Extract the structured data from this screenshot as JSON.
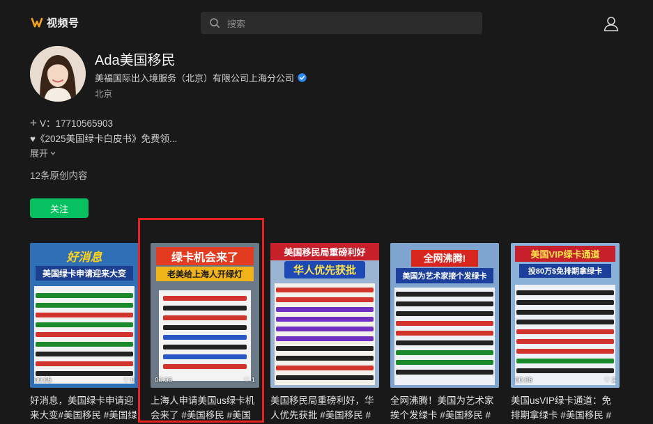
{
  "header": {
    "app_name": "视频号",
    "search_placeholder": "搜索",
    "user_icon": "user-icon"
  },
  "profile": {
    "name": "Ada美国移民",
    "company": "美福国际出入境服务（北京）有限公司上海分公司",
    "location": "北京",
    "contact": "V：17710565903",
    "description": "♥《2025美国绿卡白皮书》免费领...",
    "expand_label": "展开",
    "content_count": "12条原创内容",
    "follow_label": "关注"
  },
  "colors": {
    "accent": "#07c160",
    "background": "#191919",
    "highlight": "#e8231f",
    "verified": "#2f86f6"
  },
  "videos": [
    {
      "banner_top": "好消息",
      "banner_bottom": "美国绿卡申请迎来大变",
      "duration": "00:05",
      "likes": "0",
      "caption": "好消息，美国绿卡申请迎来大变#美国移民 #美国绿卡"
    },
    {
      "banner_top": "绿卡机会来了",
      "banner_bottom": "老美给上海人开绿灯",
      "duration": "00:06",
      "likes": "1",
      "caption": "上海人申请美国us绿卡机会来了 #美国移民 #美国绿卡"
    },
    {
      "banner_top": "美国移民局重磅利好",
      "banner_bottom": "华人优先获批",
      "duration": "",
      "likes": "",
      "caption": "美国移民局重磅利好，华人优先获批 #美国移民 #美国绿卡"
    },
    {
      "banner_top": "全网沸腾!",
      "banner_bottom": "美国为艺术家接个发绿卡",
      "duration": "",
      "likes": "",
      "caption": "全网沸腾！美国为艺术家挨个发绿卡 #美国移民 #美国绿卡"
    },
    {
      "banner_top": "美国VIP绿卡通道",
      "banner_bottom": "投80万$免排期拿绿卡",
      "duration": "00:08",
      "likes": "2",
      "caption": "美国usVIP绿卡通道：免排期拿绿卡 #美国移民 #美国绿卡"
    }
  ]
}
